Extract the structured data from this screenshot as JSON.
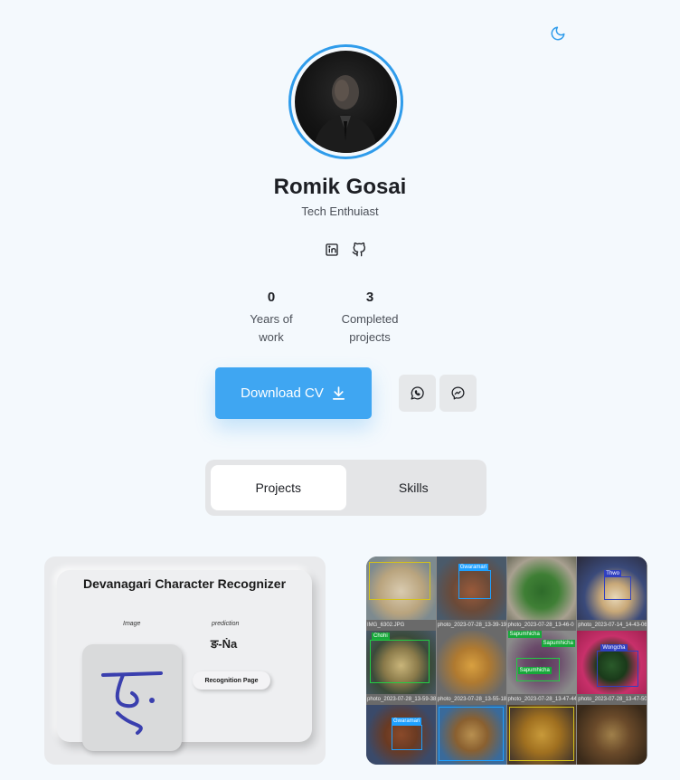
{
  "theme_toggle": {
    "icon": "moon-icon",
    "color": "#2f9ceb"
  },
  "profile": {
    "name": "Romik Gosai",
    "tagline": "Tech Enthuiast",
    "accent": "#2f9ceb"
  },
  "social": {
    "linkedin_icon": "linkedin-icon",
    "github_icon": "github-icon"
  },
  "stats": [
    {
      "value": "0",
      "label_line1": "Years of",
      "label_line2": "work"
    },
    {
      "value": "3",
      "label_line1": "Completed",
      "label_line2": "projects"
    }
  ],
  "actions": {
    "download_cv": "Download CV",
    "download_icon": "download-icon",
    "whatsapp_icon": "whatsapp-icon",
    "messenger_icon": "messenger-icon",
    "button_color": "#3fa6f2"
  },
  "tabs": [
    {
      "label": "Projects",
      "active": true
    },
    {
      "label": "Skills",
      "active": false
    }
  ],
  "projects": {
    "devanagari": {
      "title": "Devanagari Character Recognizer",
      "image_label": "Image",
      "prediction_label": "prediction",
      "prediction_value": "ङ-Ṅa",
      "button_label": "Recognition Page"
    },
    "food_detection": {
      "captions_row1": [
        "IMG_6302.JPG",
        "photo_2023-07-28_13-39-19",
        "photo_2023-07-28_13-46-0",
        "photo_2023-07-14_14-43-06"
      ],
      "captions_row2": [
        "photo_2023-07-28_13-59-38",
        "photo_2023-07-28_13-55-18",
        "photo_2023-07-28_13-47-44",
        "photo_2023-07-28_13-47-50"
      ],
      "tags": {
        "gwaramari_top": "Gwaramari",
        "thwo": "Thwo",
        "chohi": "Chohi",
        "sapumhicha_a": "Sapumhicha",
        "sapumhicha_b": "Sapumhicha",
        "sapumhicha_c": "Sapumhicha",
        "wongcha": "Wongcha",
        "gwaramari_bottom": "Gwaramari"
      }
    }
  }
}
